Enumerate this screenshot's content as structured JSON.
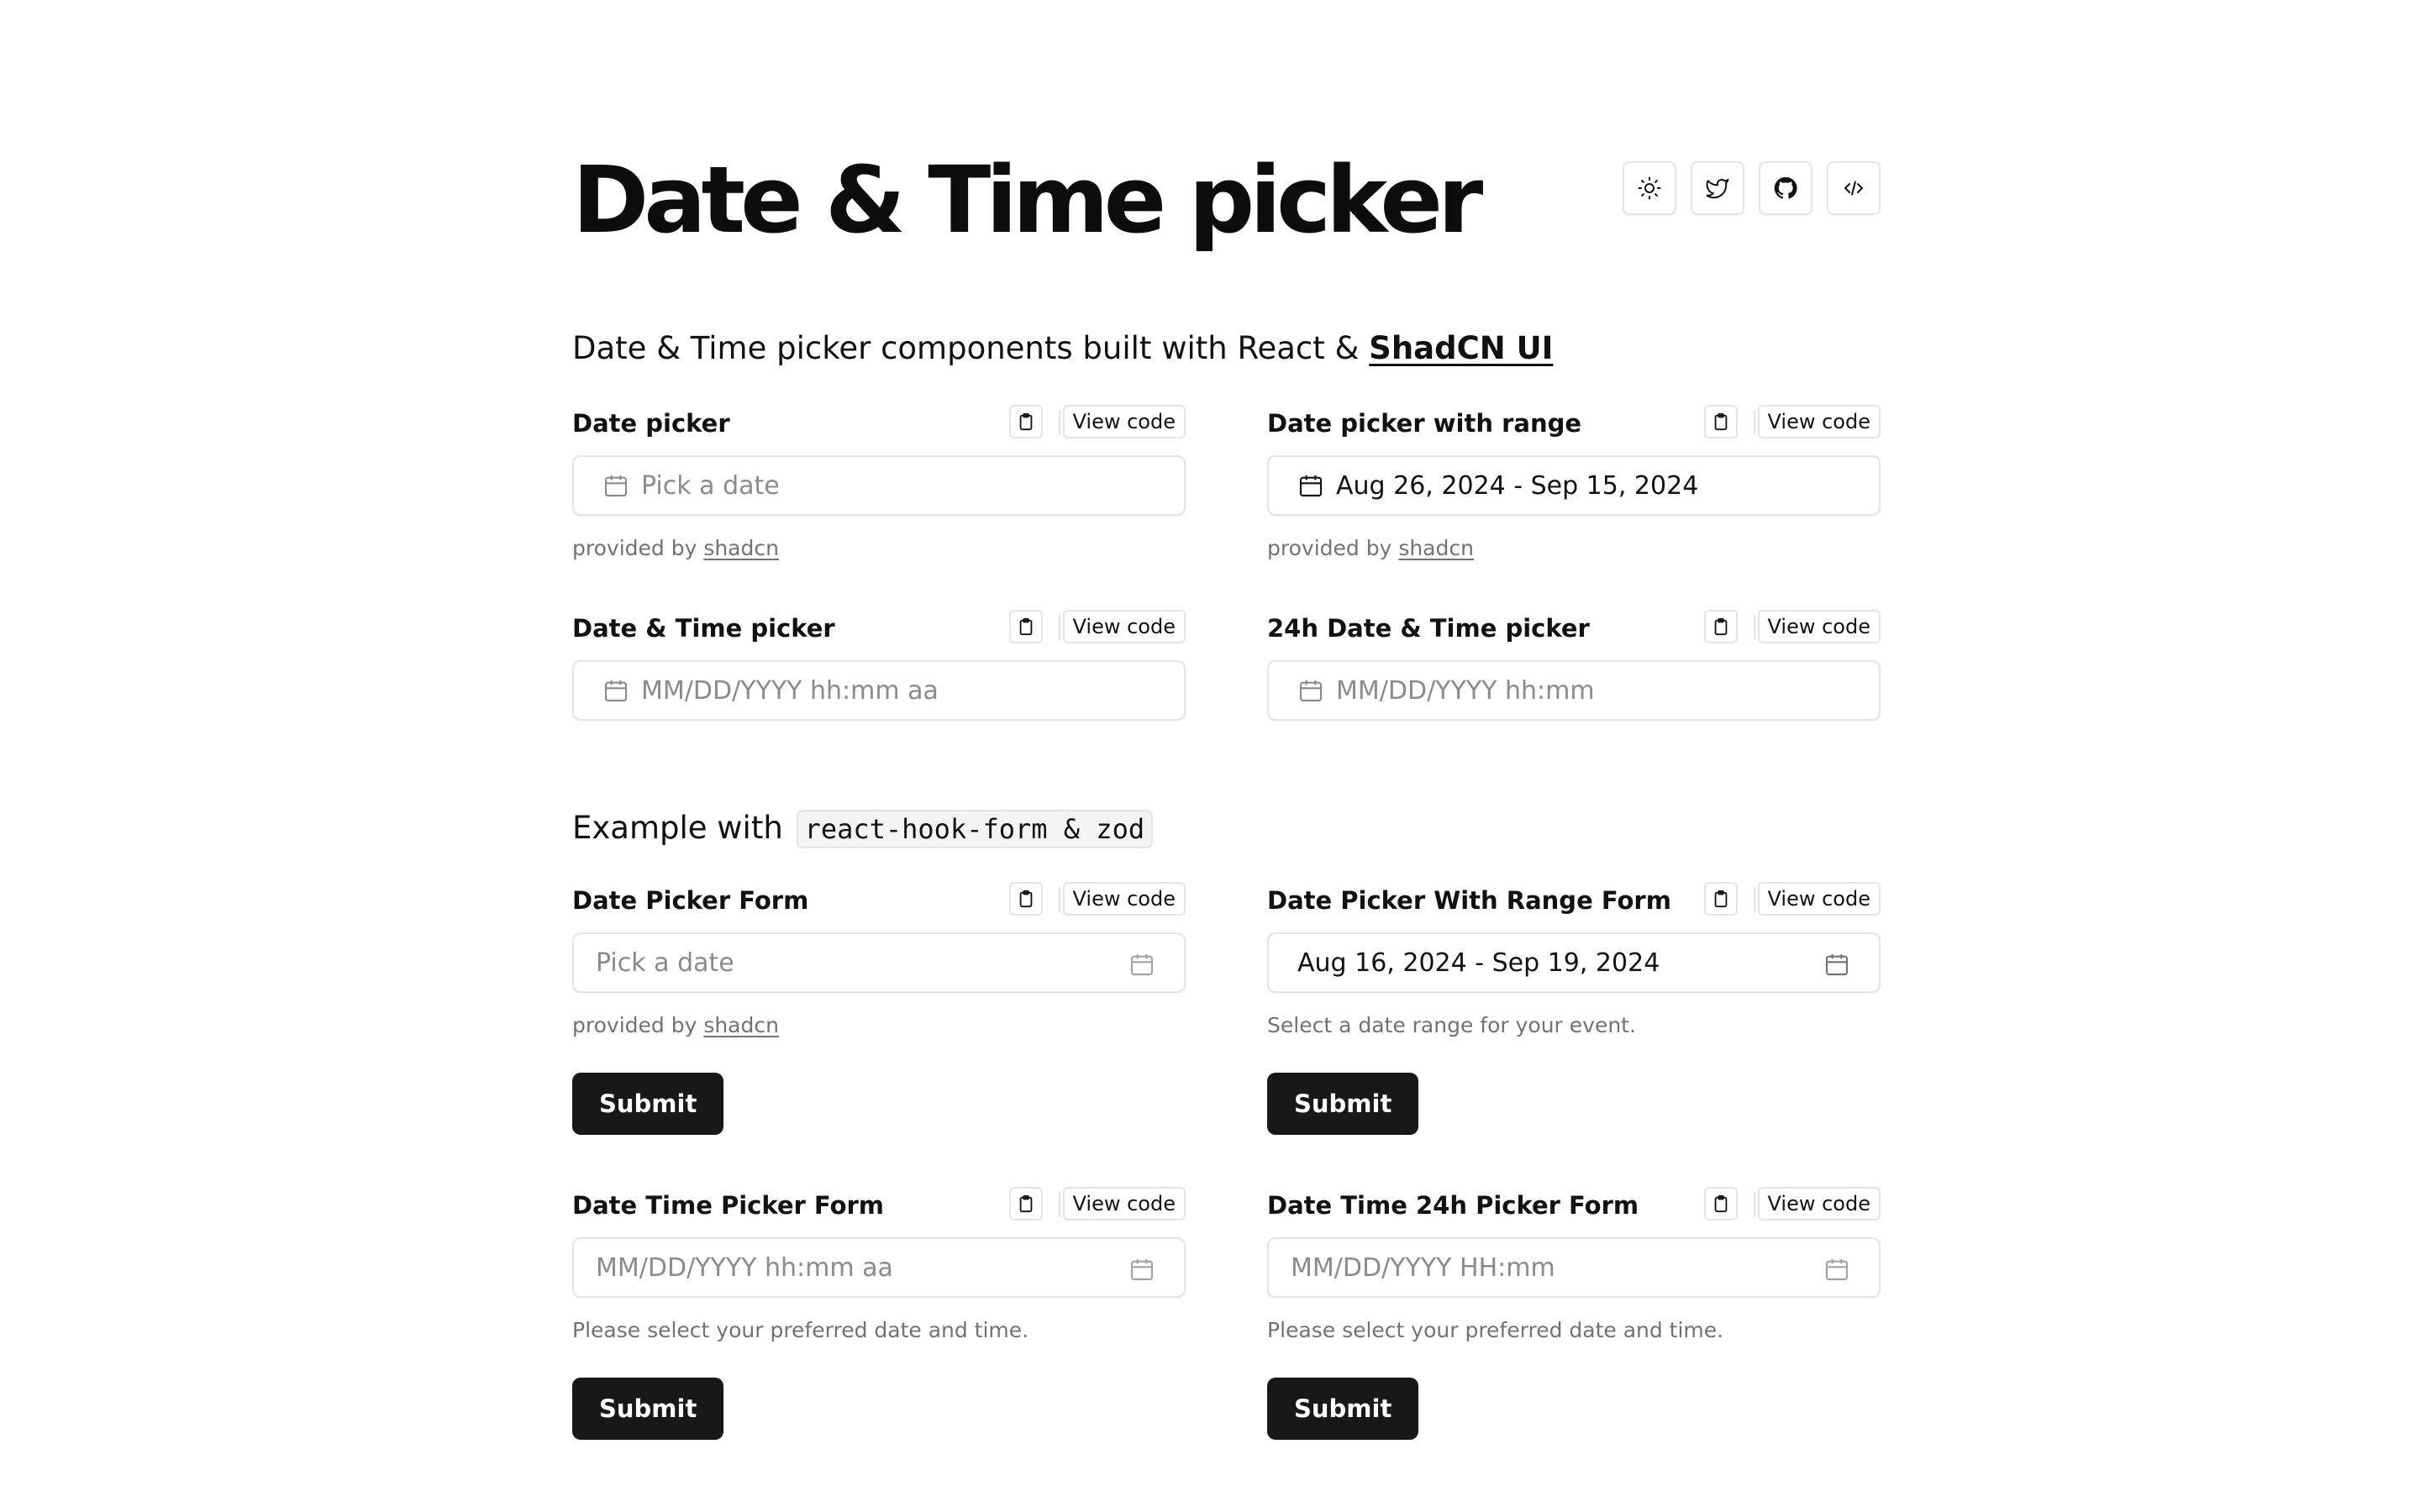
{
  "header": {
    "title": "Date & Time picker",
    "subtitle_prefix": "Date & Time picker components built with React & ",
    "subtitle_link": "ShadCN UI",
    "actions": [
      "theme-toggle-sun-icon",
      "twitter-icon",
      "github-icon",
      "code-icon"
    ]
  },
  "common": {
    "view_code": "View code",
    "submit": "Submit",
    "provided_by": "provided by ",
    "shadcn": "shadcn"
  },
  "basic": {
    "date_picker": {
      "label": "Date picker",
      "placeholder": "Pick a date"
    },
    "date_range": {
      "label": "Date picker with range",
      "value": "Aug 26, 2024 - Sep 15, 2024"
    },
    "datetime": {
      "label": "Date & Time picker",
      "placeholder": "MM/DD/YYYY hh:mm aa"
    },
    "datetime24": {
      "label": "24h Date & Time picker",
      "placeholder": "MM/DD/YYYY hh:mm"
    }
  },
  "forms": {
    "section_prefix": "Example with ",
    "section_code": "react-hook-form & zod",
    "date_form": {
      "label": "Date Picker Form",
      "placeholder": "Pick a date"
    },
    "range_form": {
      "label": "Date Picker With Range Form",
      "value": "Aug 16, 2024 - Sep 19, 2024",
      "hint": "Select a date range for your event."
    },
    "datetime_form": {
      "label": "Date Time Picker Form",
      "placeholder": "MM/DD/YYYY hh:mm aa",
      "hint": "Please select your preferred date and time."
    },
    "datetime24_form": {
      "label": "Date Time 24h Picker Form",
      "placeholder": "MM/DD/YYYY HH:mm",
      "hint": "Please select your preferred date and time."
    }
  },
  "colors": {
    "primary": "#18181b",
    "border": "#e4e4e7",
    "muted": "#71717a",
    "placeholder": "#8a8a8f"
  }
}
